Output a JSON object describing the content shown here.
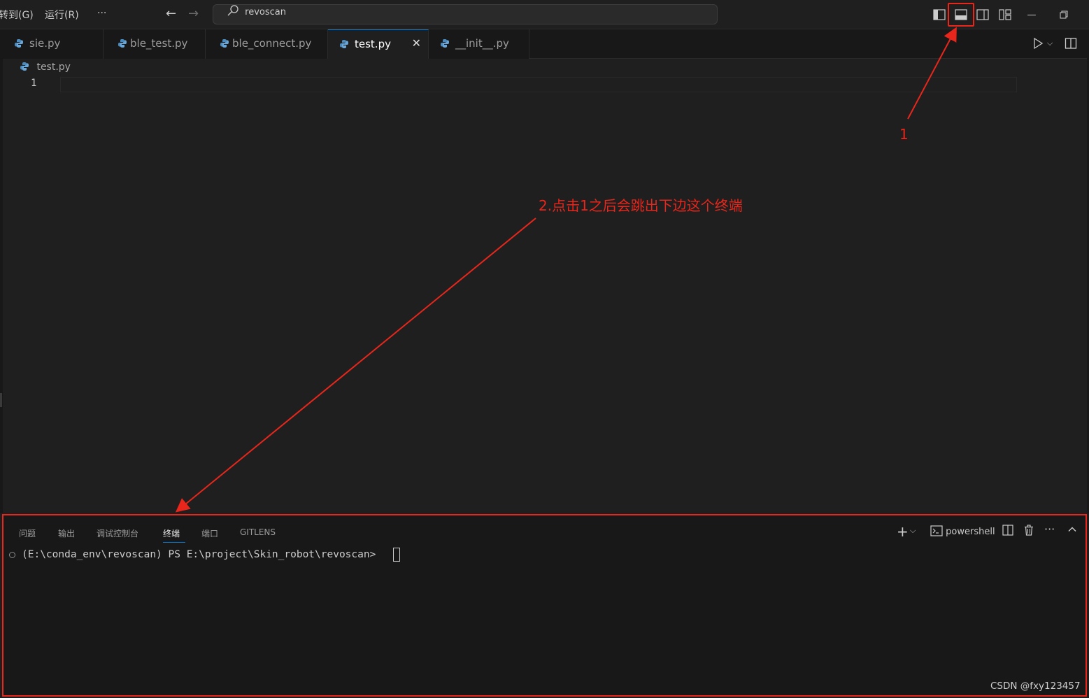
{
  "menu": {
    "goto": "转到(G)",
    "run": "运行(R)",
    "more": "···"
  },
  "search": {
    "value": "revoscan"
  },
  "tabs": [
    {
      "label": "sie.py"
    },
    {
      "label": "ble_test.py"
    },
    {
      "label": "ble_connect.py"
    },
    {
      "label": "test.py",
      "active": true
    },
    {
      "label": "__init__.py"
    }
  ],
  "editor": {
    "breadcrumb": "test.py",
    "line_number": "1"
  },
  "panel": {
    "tabs": [
      "问题",
      "输出",
      "调试控制台",
      "终端",
      "端口",
      "GITLENS"
    ],
    "active_tab": "终端",
    "shell_label": "powershell",
    "terminal_line": "(E:\\conda_env\\revoscan) PS E:\\project\\Skin_robot\\revoscan> "
  },
  "annotations": {
    "step1": "1",
    "step2": "2.点击1之后会跳出下边这个终端",
    "color": "#e8261b"
  },
  "watermark": "CSDN @fxy123457",
  "colors": {
    "accent": "#0078d4",
    "annotation": "#e8261b",
    "background": "#1f1f1f"
  }
}
